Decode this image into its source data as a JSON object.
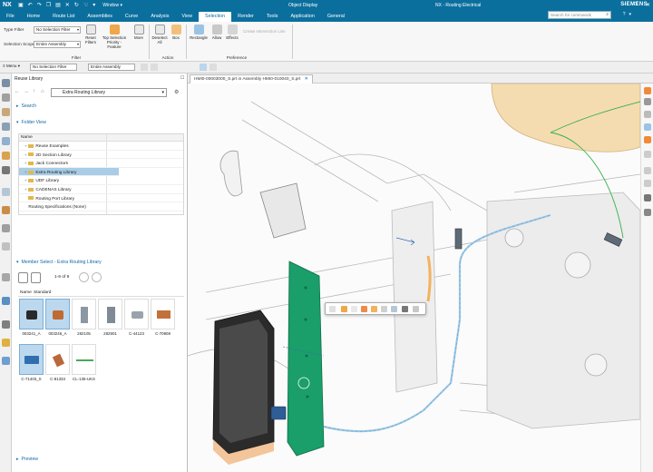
{
  "titlebar": {
    "logo": "NX",
    "window_menu": "Window ▾",
    "object_display": "Object Display",
    "app_title": "NX - Routing Electrical",
    "brand": "SIEMENS",
    "search_placeholder": "Search for commands"
  },
  "tabs": [
    "File",
    "Home",
    "Route List",
    "Assemblies",
    "Curve",
    "Analysis",
    "View",
    "Selection",
    "Render",
    "Tools",
    "Application",
    "General"
  ],
  "active_tab": "Selection",
  "ribbon": {
    "type_filter_label": "Type Filter",
    "type_filter_value": "No Selection Filter",
    "selection_scope_label": "Selection Scope",
    "selection_scope_value": "Entire Assembly",
    "reset_filters": "Reset Filters",
    "top_selection_priority": "Top Selection Priority - Feature",
    "more": "More",
    "deselect_all": "Deselect All",
    "box": "Box",
    "rectangle": "Rectangle",
    "allow": "Allow",
    "effects": "Effects",
    "create_intersection": "Create Intersection Line",
    "group_filter": "Filter",
    "group_action": "Action",
    "group_preference": "Preference"
  },
  "selbar": {
    "menu": "Menu ▾",
    "filter": "No Selection Filter",
    "scope": "Entire Assembly"
  },
  "panel": {
    "title": "Reuse Library",
    "library": "Extra Routing Library",
    "search": "Search",
    "folder_view": "Folder View",
    "tree_col": "Name",
    "folders": [
      {
        "name": "Reuse Examples",
        "expandable": true
      },
      {
        "name": "2D Section Library",
        "expandable": true
      },
      {
        "name": "Jack Connectors",
        "expandable": true
      },
      {
        "name": "Extra Routing Library",
        "expandable": true,
        "selected": true
      },
      {
        "name": "UDF Library",
        "expandable": true
      },
      {
        "name": "CADENAS Library",
        "expandable": true
      },
      {
        "name": "Routing Port Library",
        "expandable": false
      },
      {
        "name": "Routing Specifications (None)",
        "expandable": false
      }
    ],
    "member_select": "Member Select - Extra Routing Library",
    "member_count": "1-9 of 9",
    "member_cols": [
      "Name",
      "Standard"
    ],
    "members": [
      "003241_A",
      "003246_A",
      "282105",
      "282901",
      "C-44123",
      "C-70908",
      "C-71403_S",
      "C-81333",
      "CL-135-UKS"
    ],
    "selected_members": [
      "003241_A",
      "003246_A",
      "C-71403_S"
    ],
    "preview": "Preview"
  },
  "graphics": {
    "tab_label": "HMI0-00003000_S.prt in Assembly HMI0-010040_S.prt",
    "colors": {
      "plate": "#1a9e6a",
      "wire_green": "#33b04a",
      "tube_blue": "#9ecae6",
      "orange_tube": "#f2b35d"
    }
  }
}
